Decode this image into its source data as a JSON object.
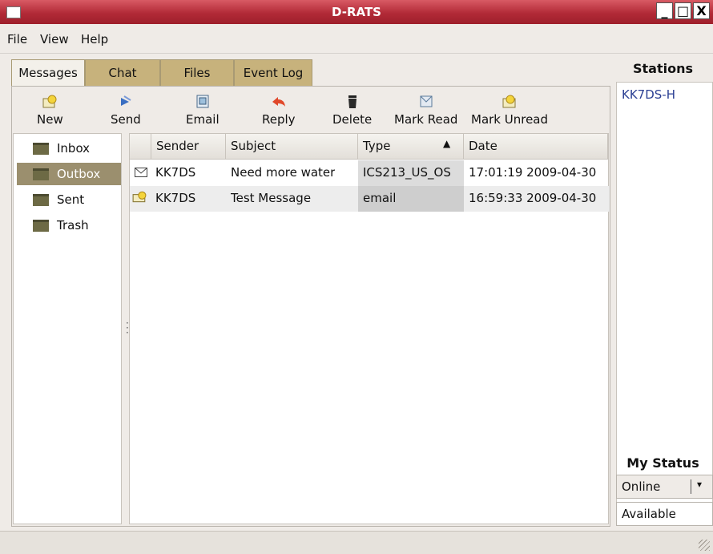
{
  "window": {
    "title": "D-RATS",
    "controls": {
      "minimize": "_",
      "maximize": "□",
      "close": "X"
    }
  },
  "menu": [
    "File",
    "View",
    "Help"
  ],
  "tabs": [
    {
      "label": "Messages",
      "active": true
    },
    {
      "label": "Chat",
      "active": false
    },
    {
      "label": "Files",
      "active": false
    },
    {
      "label": "Event Log",
      "active": false
    }
  ],
  "toolbar": [
    {
      "label": "New",
      "icon": "new-message-icon"
    },
    {
      "label": "Send",
      "icon": "send-icon"
    },
    {
      "label": "Email",
      "icon": "email-icon"
    },
    {
      "label": "Reply",
      "icon": "reply-icon"
    },
    {
      "label": "Delete",
      "icon": "delete-icon"
    },
    {
      "label": "Mark Read",
      "icon": "mark-read-icon"
    },
    {
      "label": "Mark Unread",
      "icon": "mark-unread-icon"
    }
  ],
  "folders": [
    {
      "label": "Inbox",
      "selected": false
    },
    {
      "label": "Outbox",
      "selected": true
    },
    {
      "label": "Sent",
      "selected": false
    },
    {
      "label": "Trash",
      "selected": false
    }
  ],
  "message_list": {
    "columns": [
      "Sender",
      "Subject",
      "Type",
      "Date"
    ],
    "sort_indicator": "▲",
    "rows": [
      {
        "icon": "envelope-icon",
        "sender": "KK7DS",
        "subject": "Need more water",
        "type": "ICS213_US_OS",
        "date": "17:01:19 2009-04-30"
      },
      {
        "icon": "new-message-icon",
        "sender": "KK7DS",
        "subject": "Test Message",
        "type": "email",
        "date": "16:59:33 2009-04-30"
      }
    ]
  },
  "stations": {
    "header": "Stations",
    "items": [
      "KK7DS-H"
    ]
  },
  "my_status": {
    "header": "My Status",
    "selected": "Online",
    "dropdown_arrow": "▾",
    "message": "Available"
  },
  "colors": {
    "title_bar": "#c0343f",
    "tab_inactive": "#c7b27c",
    "folder_selected": "#9b8f6e",
    "station_link": "#2b3f93",
    "reply_icon": "#e0482a"
  }
}
